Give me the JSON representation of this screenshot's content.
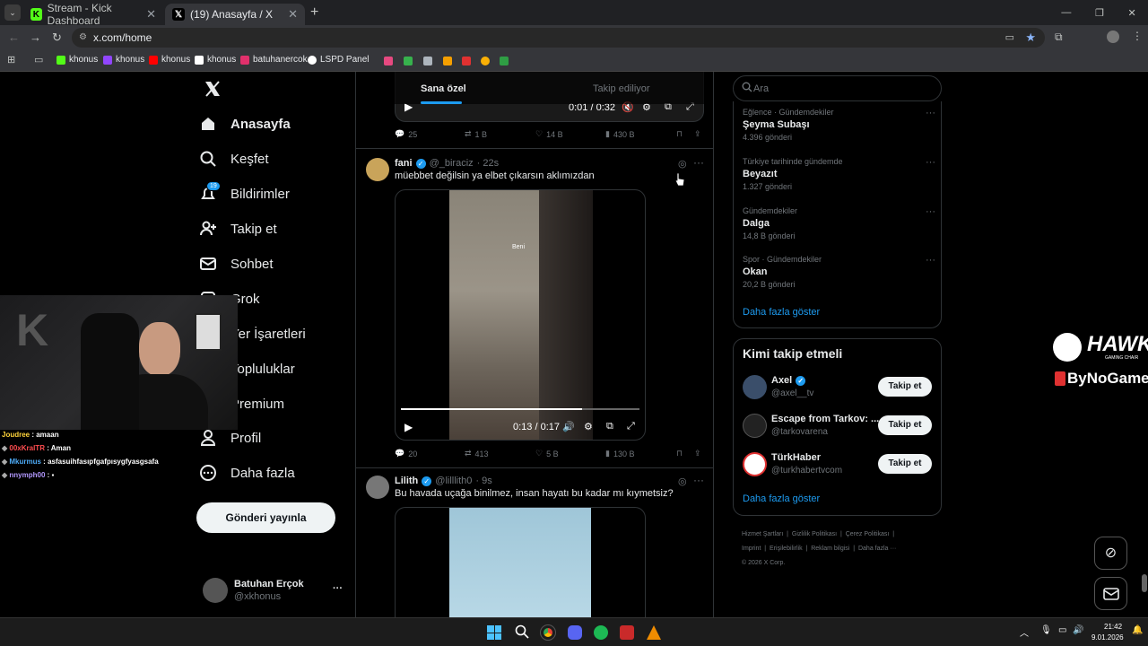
{
  "browser": {
    "tabs": [
      {
        "label": "Stream - Kick Dashboard",
        "icon": "kick-icon"
      },
      {
        "label": "(19) Anasayfa / X",
        "icon": "x-logo-icon"
      }
    ],
    "new_tab": "+",
    "url": "x.com/home",
    "bookmarks": [
      "khonus",
      "khonus",
      "khonus",
      "khonus",
      "batuhanercok",
      "LSPD Panel"
    ]
  },
  "sidebar": {
    "items": [
      {
        "label": "Anasayfa",
        "icon": "home-icon"
      },
      {
        "label": "Keşfet",
        "icon": "search-icon"
      },
      {
        "label": "Bildirimler",
        "icon": "bell-icon",
        "badge": "19"
      },
      {
        "label": "Takip et",
        "icon": "person-add-icon"
      },
      {
        "label": "Sohbet",
        "icon": "mail-icon"
      },
      {
        "label": "Grok",
        "icon": "grok-icon"
      },
      {
        "label": "Yer İşaretleri",
        "icon": "bookmark-icon"
      },
      {
        "label": "Topluluklar",
        "icon": "communities-icon"
      },
      {
        "label": "Premium",
        "icon": "premium-icon"
      },
      {
        "label": "Profil",
        "icon": "profile-icon"
      },
      {
        "label": "Daha fazla",
        "icon": "more-circle-icon"
      }
    ],
    "post_button": "Gönderi yayınla",
    "account": {
      "name": "Batuhan Erçok",
      "handle": "@xkhonus",
      "menu": "···"
    }
  },
  "feed": {
    "tabs": [
      "Sana özel",
      "Takip ediliyor"
    ],
    "top_video": {
      "time": "0:01 / 0:32",
      "stats": {
        "replies": "25",
        "reposts": "1 B",
        "likes": "14 B",
        "views": "430 B"
      }
    },
    "posts": [
      {
        "name": "fani",
        "handle": "@_biraciz",
        "time": "· 22s",
        "text": "müebbet değilsin ya elbet çıkarsın aklımızdan",
        "video_caption": "Beni",
        "video_time": "0:13 / 0:17",
        "stats": {
          "replies": "20",
          "reposts": "413",
          "likes": "5 B",
          "views": "130 B"
        }
      },
      {
        "name": "Lilith",
        "handle": "@lilllith0",
        "time": "· 9s",
        "text": "Bu havada uçağa binilmez, insan hayatı bu kadar mı kıymetsiz?"
      }
    ]
  },
  "right": {
    "search_placeholder": "Ara",
    "trends": [
      {
        "category": "Eğlence · Gündemdekiler",
        "name": "Şeyma Subaşı",
        "count": "4.396 gönderi"
      },
      {
        "category": "Türkiye tarihinde gündemde",
        "name": "Beyazıt",
        "count": "1.327 gönderi"
      },
      {
        "category": "Gündemdekiler",
        "name": "Dalga",
        "count": "14,8 B gönderi"
      },
      {
        "category": "Spor · Gündemdekiler",
        "name": "Okan",
        "count": "20,2 B gönderi"
      }
    ],
    "trends_more": "Daha fazla göster",
    "who_title": "Kimi takip etmeli",
    "who": [
      {
        "name": "Axel",
        "handle": "@axel__tv",
        "button": "Takip et"
      },
      {
        "name": "Escape from Tarkov: ...",
        "handle": "@tarkovarena",
        "button": "Takip et"
      },
      {
        "name": "TürkHaber",
        "handle": "@turkhabertvcom",
        "button": "Takip et"
      }
    ],
    "who_more": "Daha fazla göster",
    "footer": [
      "Hizmet Şartları",
      "Gizlilik Politikası",
      "Çerez Politikası",
      "Imprint",
      "Erişilebilirlik",
      "Reklam bilgisi",
      "Daha fazla ···",
      "© 2026 X Corp."
    ]
  },
  "overlay": {
    "brand": "HAWK",
    "brand_sub": "GAMING CHAIR",
    "sponsor": "ByNoGame",
    "chat": [
      {
        "user": "Joudree",
        "msg": "amaan",
        "color": "#ffd43b"
      },
      {
        "user": "00xKralTR",
        "msg": "Aman",
        "color": "#ff4d4f"
      },
      {
        "user": "Mkurmus",
        "msg": "asfasuihfasıpfgafpısygfyasgsafa",
        "color": "#4dabf7"
      },
      {
        "user": "nnymph00",
        "msg": "",
        "color": "#b197fc"
      }
    ]
  },
  "taskbar": {
    "time": "21:42",
    "date": "9.01.2026"
  }
}
